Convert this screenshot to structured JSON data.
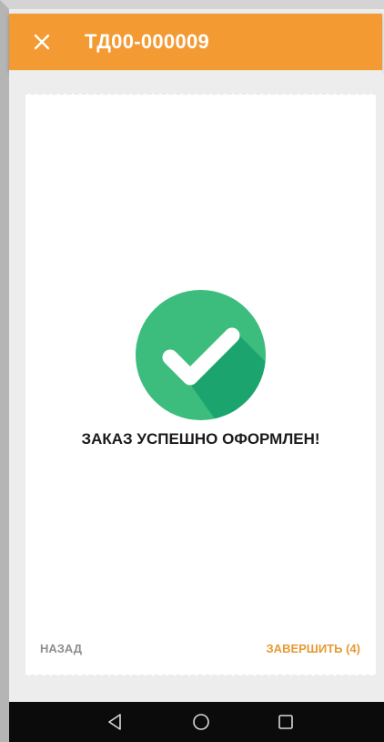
{
  "header": {
    "title": "ТД00-000009",
    "close_icon": "close-icon",
    "background_color": "#f39a33"
  },
  "result": {
    "icon": "checkmark-circle-icon",
    "icon_color": "#3dbd7d",
    "message": "ЗАКАЗ УСПЕШНО ОФОРМЛЕН!"
  },
  "actions": {
    "back_label": "НАЗАД",
    "finish_label": "ЗАВЕРШИТЬ (4)",
    "finish_color": "#e79a33"
  },
  "system_nav": {
    "back_icon": "triangle-back-icon",
    "home_icon": "circle-home-icon",
    "recents_icon": "square-recents-icon"
  }
}
